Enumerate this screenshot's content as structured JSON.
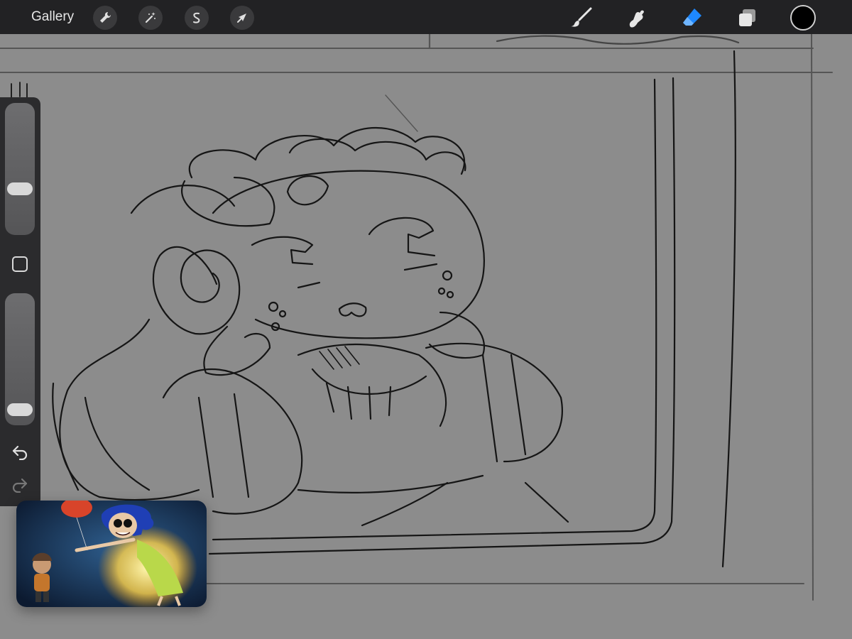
{
  "app": {
    "gallery_label": "Gallery"
  },
  "toolbar": {
    "left_tools": [
      "wrench-icon",
      "magic-wand-icon",
      "selection-icon",
      "transform-arrow-icon"
    ],
    "right_tools": [
      "brush-icon",
      "smudge-icon",
      "eraser-icon",
      "layers-icon"
    ],
    "active_tool": "eraser-icon",
    "active_color": "#000000",
    "accent_color": "#1e88ff"
  },
  "sidebar": {
    "brush_size_level": 0.33,
    "opacity_level": 0.06,
    "icons": [
      "undo-icon",
      "redo-icon"
    ]
  },
  "canvas": {
    "background": "#8c8c8c"
  },
  "pip": {
    "content": "video-thumbnail"
  }
}
